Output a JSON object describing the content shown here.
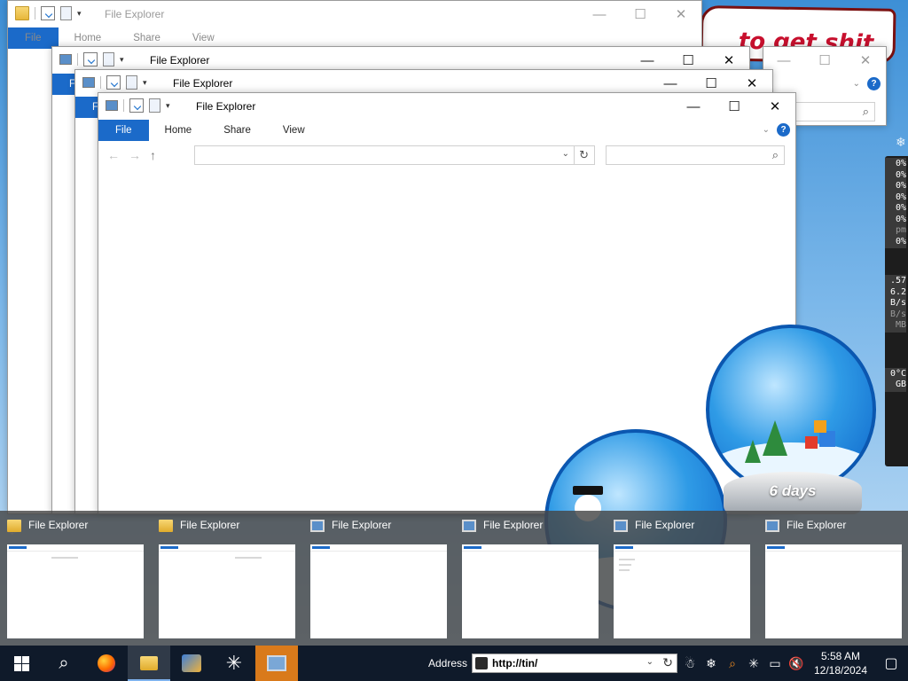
{
  "windows": {
    "back": {
      "title": "File Explorer",
      "tabs": [
        "File",
        "Home",
        "Share",
        "View"
      ]
    },
    "w2": {
      "title": "File Explorer"
    },
    "w3": {
      "title": "File Explorer"
    },
    "front": {
      "title": "File Explorer",
      "tabs": [
        "File",
        "Home",
        "Share",
        "View"
      ],
      "help": "?"
    }
  },
  "window_buttons": {
    "minimize": "—",
    "maximize": "☐",
    "close": "✕"
  },
  "icons": {
    "back": "←",
    "forward": "→",
    "up": "↑",
    "dropdown": "⌄",
    "refresh": "↻",
    "search": "⌕",
    "quick_access_dropdown": "▾"
  },
  "banner_text": "to get shit",
  "globe_label": "6 days",
  "gauge": [
    "0%",
    "0%",
    "0%",
    "0%",
    "0%",
    "0%",
    "pm",
    "0%",
    "",
    ".57",
    "6.2",
    "B/s",
    "B/s",
    "MB",
    "",
    "",
    "0°C",
    "GB"
  ],
  "switcher": {
    "items": [
      {
        "title": "File Explorer",
        "icon": "folder-icon"
      },
      {
        "title": "File Explorer",
        "icon": "folder-icon"
      },
      {
        "title": "File Explorer",
        "icon": "this-pc-icon"
      },
      {
        "title": "File Explorer",
        "icon": "this-pc-icon"
      },
      {
        "title": "File Explorer",
        "icon": "this-pc-icon"
      },
      {
        "title": "File Explorer",
        "icon": "this-pc-icon"
      }
    ]
  },
  "taskbar": {
    "address_label": "Address",
    "address_value": "http://tin/",
    "time": "5:58 AM",
    "date": "12/18/2024"
  },
  "colors": {
    "accent": "#1b6ac9",
    "taskbar": "#0f1a2a",
    "switcher": "#464646"
  }
}
